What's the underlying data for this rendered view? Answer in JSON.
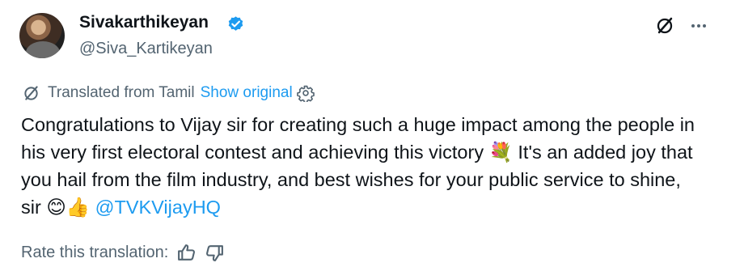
{
  "author": {
    "name": "Sivakarthikeyan",
    "handle": "@Siva_Kartikeyan"
  },
  "translation": {
    "label": "Translated from Tamil",
    "show_original": "Show original"
  },
  "tweet": {
    "text_main": "Congratulations to Vijay sir for creating such a huge impact among the people in his very first electoral contest and achieving this victory",
    "emoji_bouquet": "💐",
    "text_second": " It's an added joy that you hail from the film industry, and best wishes for your public service to shine, sir ",
    "emoji_smile": "😊",
    "emoji_thumbs": "👍",
    "mention": "@TVKVijayHQ"
  },
  "rating": {
    "label": "Rate this translation:"
  },
  "icons": {
    "verified": "verified-badge-icon",
    "grok": "grok-icon",
    "more": "more-options-icon",
    "settings": "gear-icon",
    "thumbs_up": "thumbs-up-icon",
    "thumbs_down": "thumbs-down-icon"
  },
  "colors": {
    "accent": "#1d9bf0",
    "secondary_text": "#536471",
    "primary_text": "#0f1419"
  }
}
